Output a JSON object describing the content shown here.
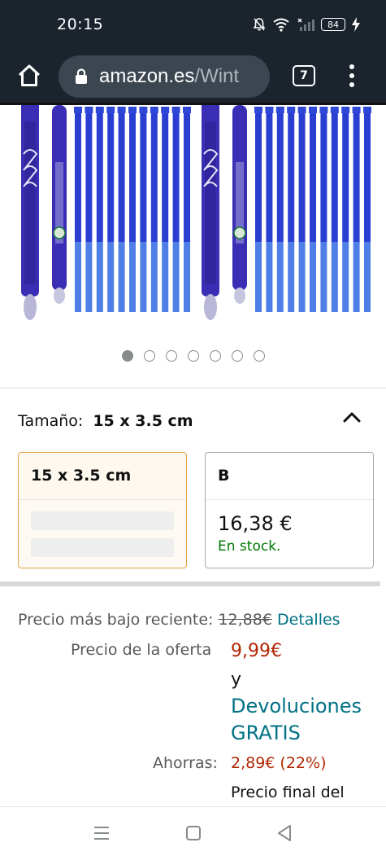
{
  "status_bar": {
    "time": "20:15",
    "battery": "84",
    "icons": [
      "mute-icon",
      "wifi-icon",
      "signal-icon",
      "battery-icon",
      "charging-icon"
    ]
  },
  "browser": {
    "url_host": "amazon.es",
    "url_path": "/Wint",
    "tab_count": "7",
    "icons": [
      "home-icon",
      "lock-icon",
      "tabs-icon",
      "more-icon"
    ]
  },
  "gallery": {
    "image_count": 7,
    "active_index": 0,
    "colors": {
      "pen_body": "#3a2fb4",
      "pen_refill": "#2a3fd1",
      "refill_tip": "#4f7fe6"
    }
  },
  "size": {
    "label": "Tamaño:",
    "value": "15 x 3.5 cm",
    "options": [
      {
        "name": "15 x 3.5 cm",
        "price": "",
        "stock": "",
        "selected": true
      },
      {
        "name": "B",
        "price": "16,38 €",
        "stock": "En stock.",
        "selected": false
      }
    ]
  },
  "pricing": {
    "recent_low_label": "Precio más bajo reciente:",
    "recent_low_value": "12,88€",
    "details_link": "Detalles",
    "offer_label": "Precio de la oferta",
    "offer_value": "9,99€",
    "and": "y",
    "returns_line1": "Devoluciones",
    "returns_line2": "GRATIS",
    "savings_label": "Ahorras:",
    "savings_value": "2,89€ (22%)",
    "final_price_label": "Precio final del"
  },
  "colors": {
    "link": "#007185",
    "price_red": "#b12704",
    "in_stock_green": "#007600",
    "selected_border": "#e3a34a"
  }
}
